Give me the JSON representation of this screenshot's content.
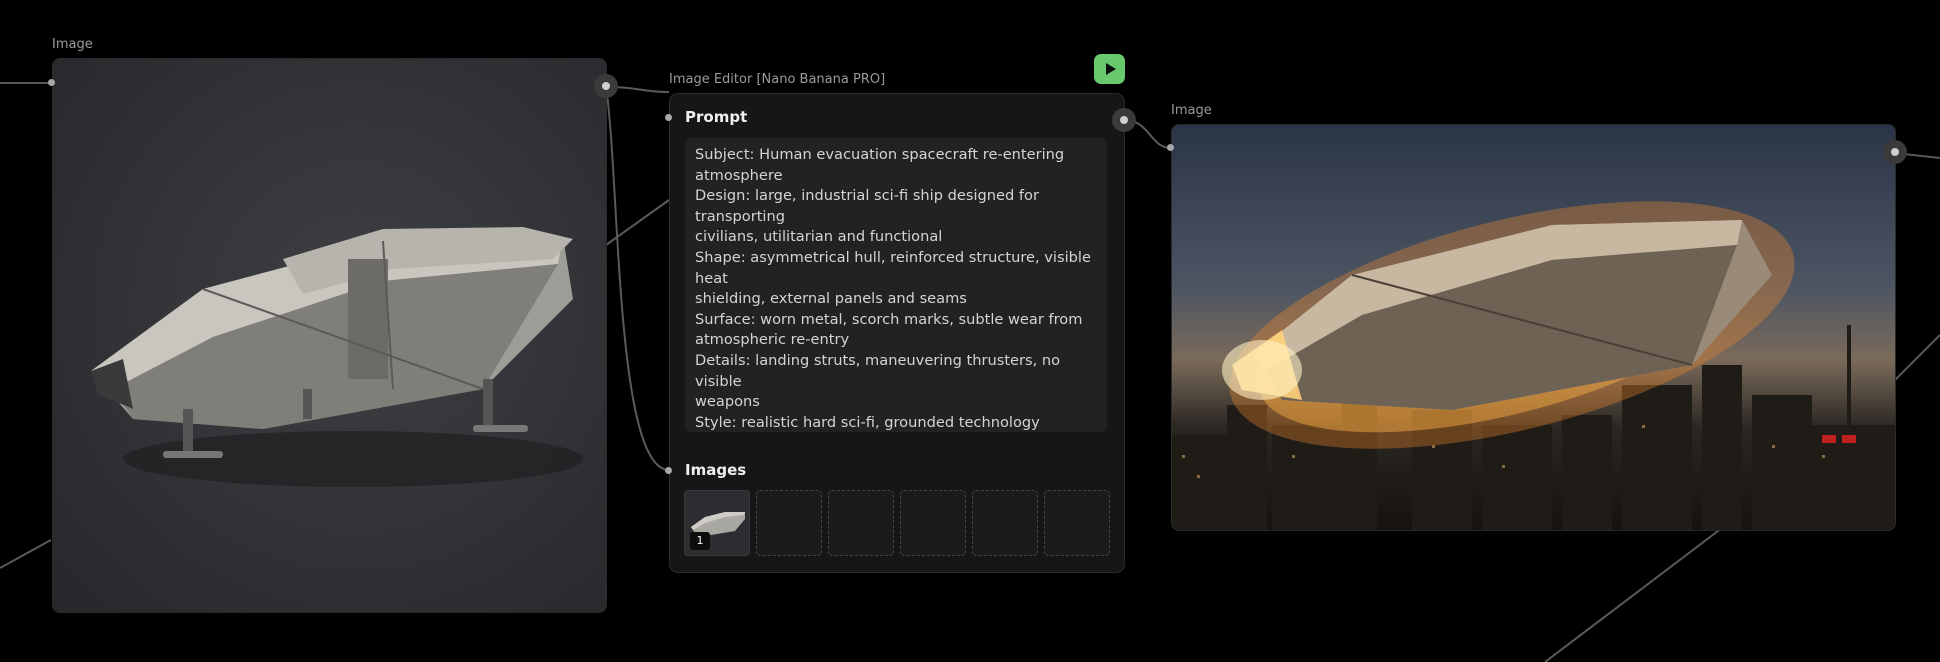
{
  "nodes": {
    "source_image": {
      "label": "Image"
    },
    "editor": {
      "title": "Image Editor [Nano Banana PRO]",
      "prompt_label": "Prompt",
      "prompt_text": "Subject: Human evacuation spacecraft re-entering\natmosphere\nDesign: large, industrial sci-fi ship designed for transporting\ncivilians, utilitarian and functional\nShape: asymmetrical hull, reinforced structure, visible heat\nshielding, external panels and seams\nSurface: worn metal, scorch marks, subtle wear from\natmospheric re-entry\nDetails: landing struts, maneuvering thrusters, no visible\nweapons\nStyle: realistic hard sci-fi, grounded technology\nColor palette: muted grays and off-whites, minimal accent\nlighting...",
      "images_label": "Images",
      "slot_badge": "1",
      "run_icon": "play-icon"
    },
    "output_image": {
      "label": "Image"
    }
  },
  "colors": {
    "background": "#000000",
    "node_bg": "#161616",
    "run_button": "#67c86d",
    "wire": "#5a5a5a"
  }
}
